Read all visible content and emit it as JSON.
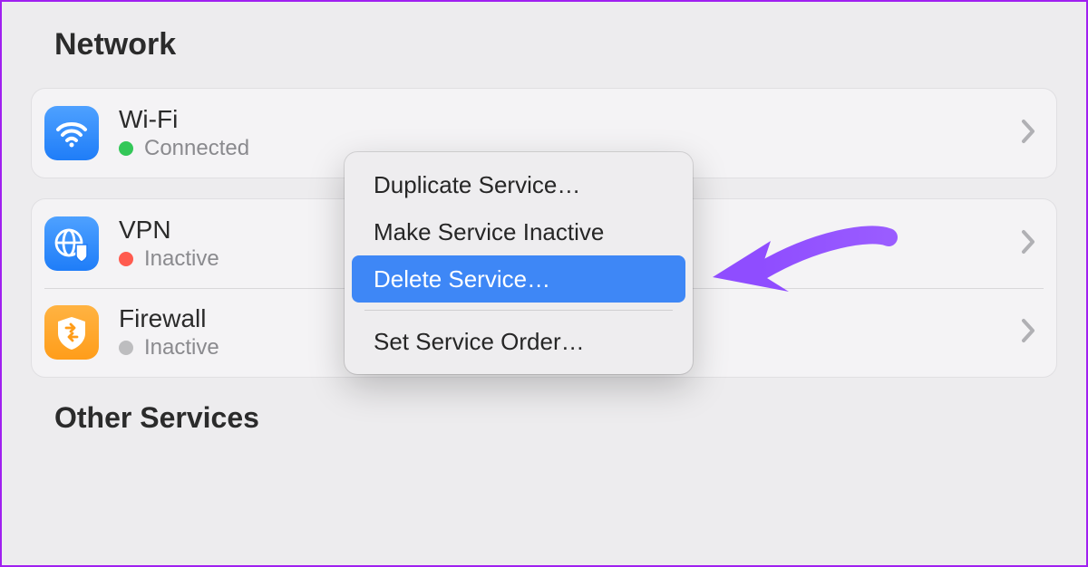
{
  "section_title": "Network",
  "services": [
    {
      "name": "Wi-Fi",
      "status_label": "Connected",
      "status_color": "#33c758",
      "icon": "wifi"
    },
    {
      "name": "VPN",
      "status_label": "Inactive",
      "status_color": "#ff5b4f",
      "icon": "vpn"
    },
    {
      "name": "Firewall",
      "status_label": "Inactive",
      "status_color": "#bdbdbf",
      "icon": "firewall"
    }
  ],
  "context_menu": {
    "items": [
      {
        "label": "Duplicate Service…",
        "highlight": false
      },
      {
        "label": "Make Service Inactive",
        "highlight": false
      },
      {
        "label": "Delete Service…",
        "highlight": true
      },
      {
        "type": "separator"
      },
      {
        "label": "Set Service Order…",
        "highlight": false
      }
    ]
  },
  "other_section_title": "Other Services",
  "colors": {
    "accent": "#3e87f6",
    "annotation": "#8f4dff"
  }
}
